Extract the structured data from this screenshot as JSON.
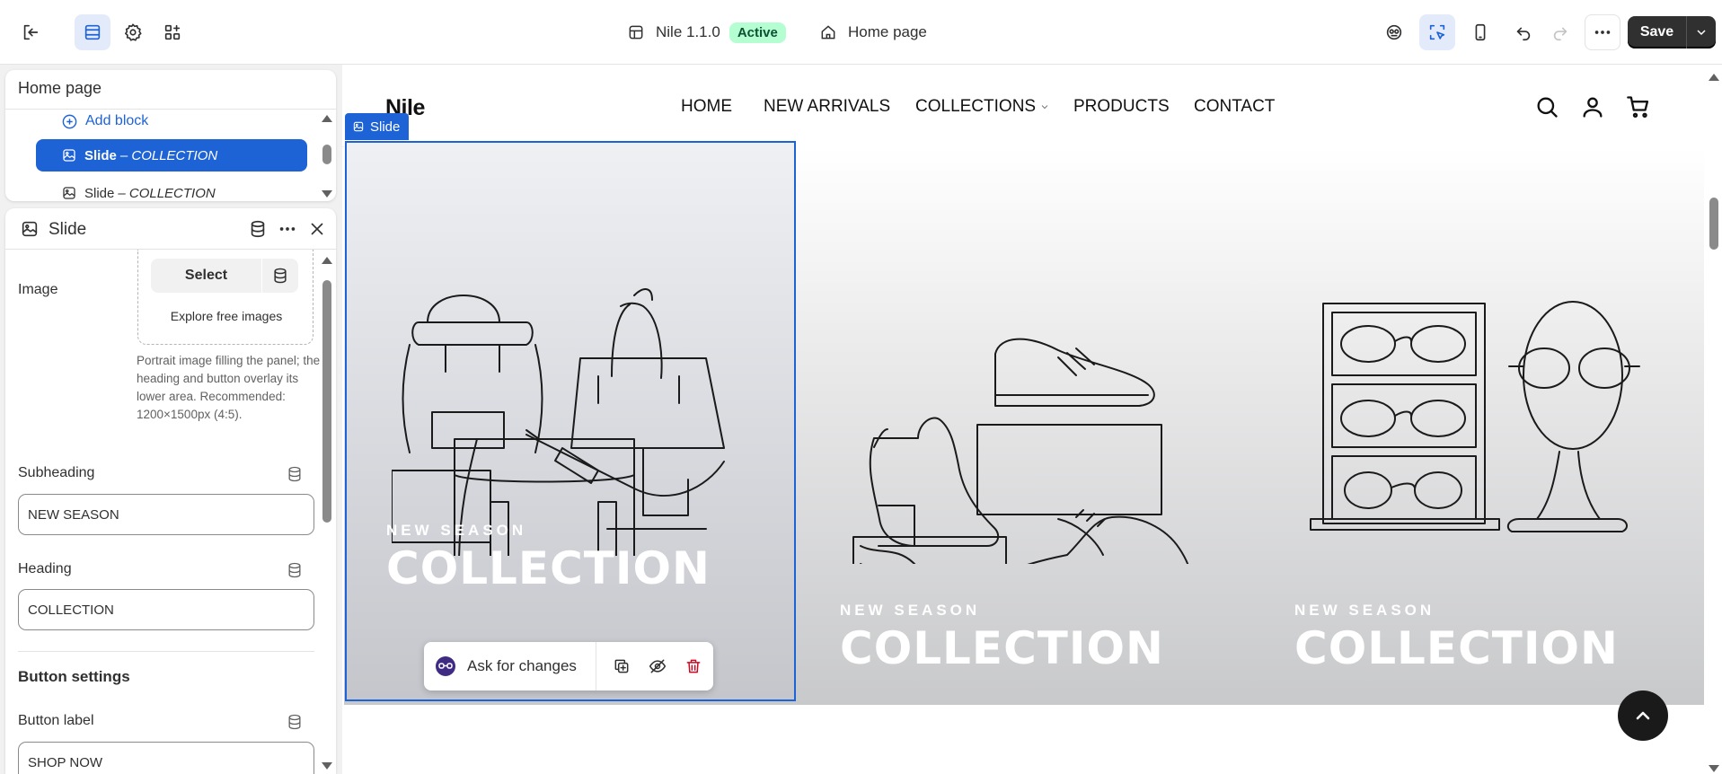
{
  "topbar": {
    "theme_name": "Nile 1.1.0",
    "theme_status": "Active",
    "page_selector": "Home page",
    "save_label": "Save",
    "icons": [
      "exit-icon",
      "sections-icon",
      "gear-icon",
      "apps-icon",
      "theme-icon",
      "home-icon",
      "preview-inspector-icon",
      "select-element-icon",
      "mobile-view-icon",
      "undo-icon",
      "redo-icon",
      "more-icon",
      "chevron-down-icon"
    ]
  },
  "tree": {
    "title": "Home page",
    "add_block": "Add block",
    "items": [
      {
        "label": "Slide",
        "detail": "– COLLECTION",
        "selected": true
      },
      {
        "label": "Slide",
        "detail": "– COLLECTION",
        "selected": false
      }
    ]
  },
  "settings": {
    "title": "Slide",
    "image": {
      "label": "Image",
      "select_label": "Select",
      "explore_label": "Explore free images",
      "help": "Portrait image filling the panel; the heading and button overlay its lower area. Recommended: 1200×1500px (4:5)."
    },
    "subheading": {
      "label": "Subheading",
      "value": "NEW SEASON"
    },
    "heading": {
      "label": "Heading",
      "value": "COLLECTION"
    },
    "button_settings_title": "Button settings",
    "button_label": {
      "label": "Button label",
      "value": "SHOP NOW"
    }
  },
  "preview": {
    "logo": "Nile",
    "nav": [
      "HOME",
      "NEW ARRIVALS",
      "COLLECTIONS",
      "PRODUCTS",
      "CONTACT"
    ],
    "slide_tag": "Slide",
    "slides": [
      {
        "subheading": "NEW SEASON",
        "heading": "COLLECTION",
        "image": "bags-illustration"
      },
      {
        "subheading": "NEW SEASON",
        "heading": "COLLECTION",
        "image": "shoes-illustration"
      },
      {
        "subheading": "NEW SEASON",
        "heading": "COLLECTION",
        "image": "eyewear-illustration"
      }
    ],
    "ask_label": "Ask for changes"
  },
  "colors": {
    "accent": "#1d63d6",
    "active_badge_bg": "#b4fed2",
    "active_badge_text": "#0c5132",
    "save_bg": "#303030"
  }
}
